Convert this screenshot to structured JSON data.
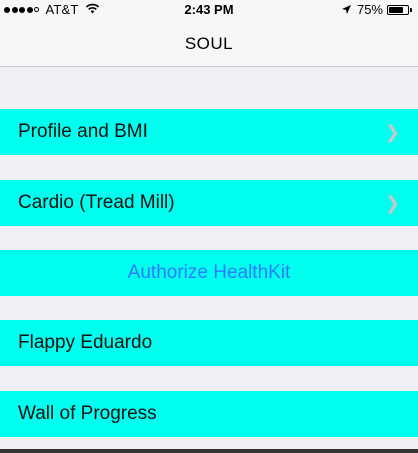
{
  "status_bar": {
    "carrier": "AT&T",
    "time": "2:43 PM",
    "battery": "75%",
    "battery_level": 0.75,
    "signal_bars": 4,
    "icons": [
      "signal-icon",
      "wifi-icon",
      "location-arrow-icon",
      "battery-icon"
    ]
  },
  "nav": {
    "title": "SOUL"
  },
  "table": {
    "rows": [
      {
        "label": "Profile and BMI",
        "has_disclosure": true
      },
      {
        "label": "Cardio (Tread Mill)",
        "has_disclosure": true
      },
      {
        "label": "Authorize HealthKit",
        "has_disclosure": false
      },
      {
        "label": "Flappy Eduardo",
        "has_disclosure": false
      },
      {
        "label": "Wall of Progress",
        "has_disclosure": false
      }
    ]
  },
  "colors": {
    "cell_background": "#00ffee",
    "table_background": "#efeff4",
    "tint": "#2f7bff",
    "chevron": "#c7c7cc"
  }
}
